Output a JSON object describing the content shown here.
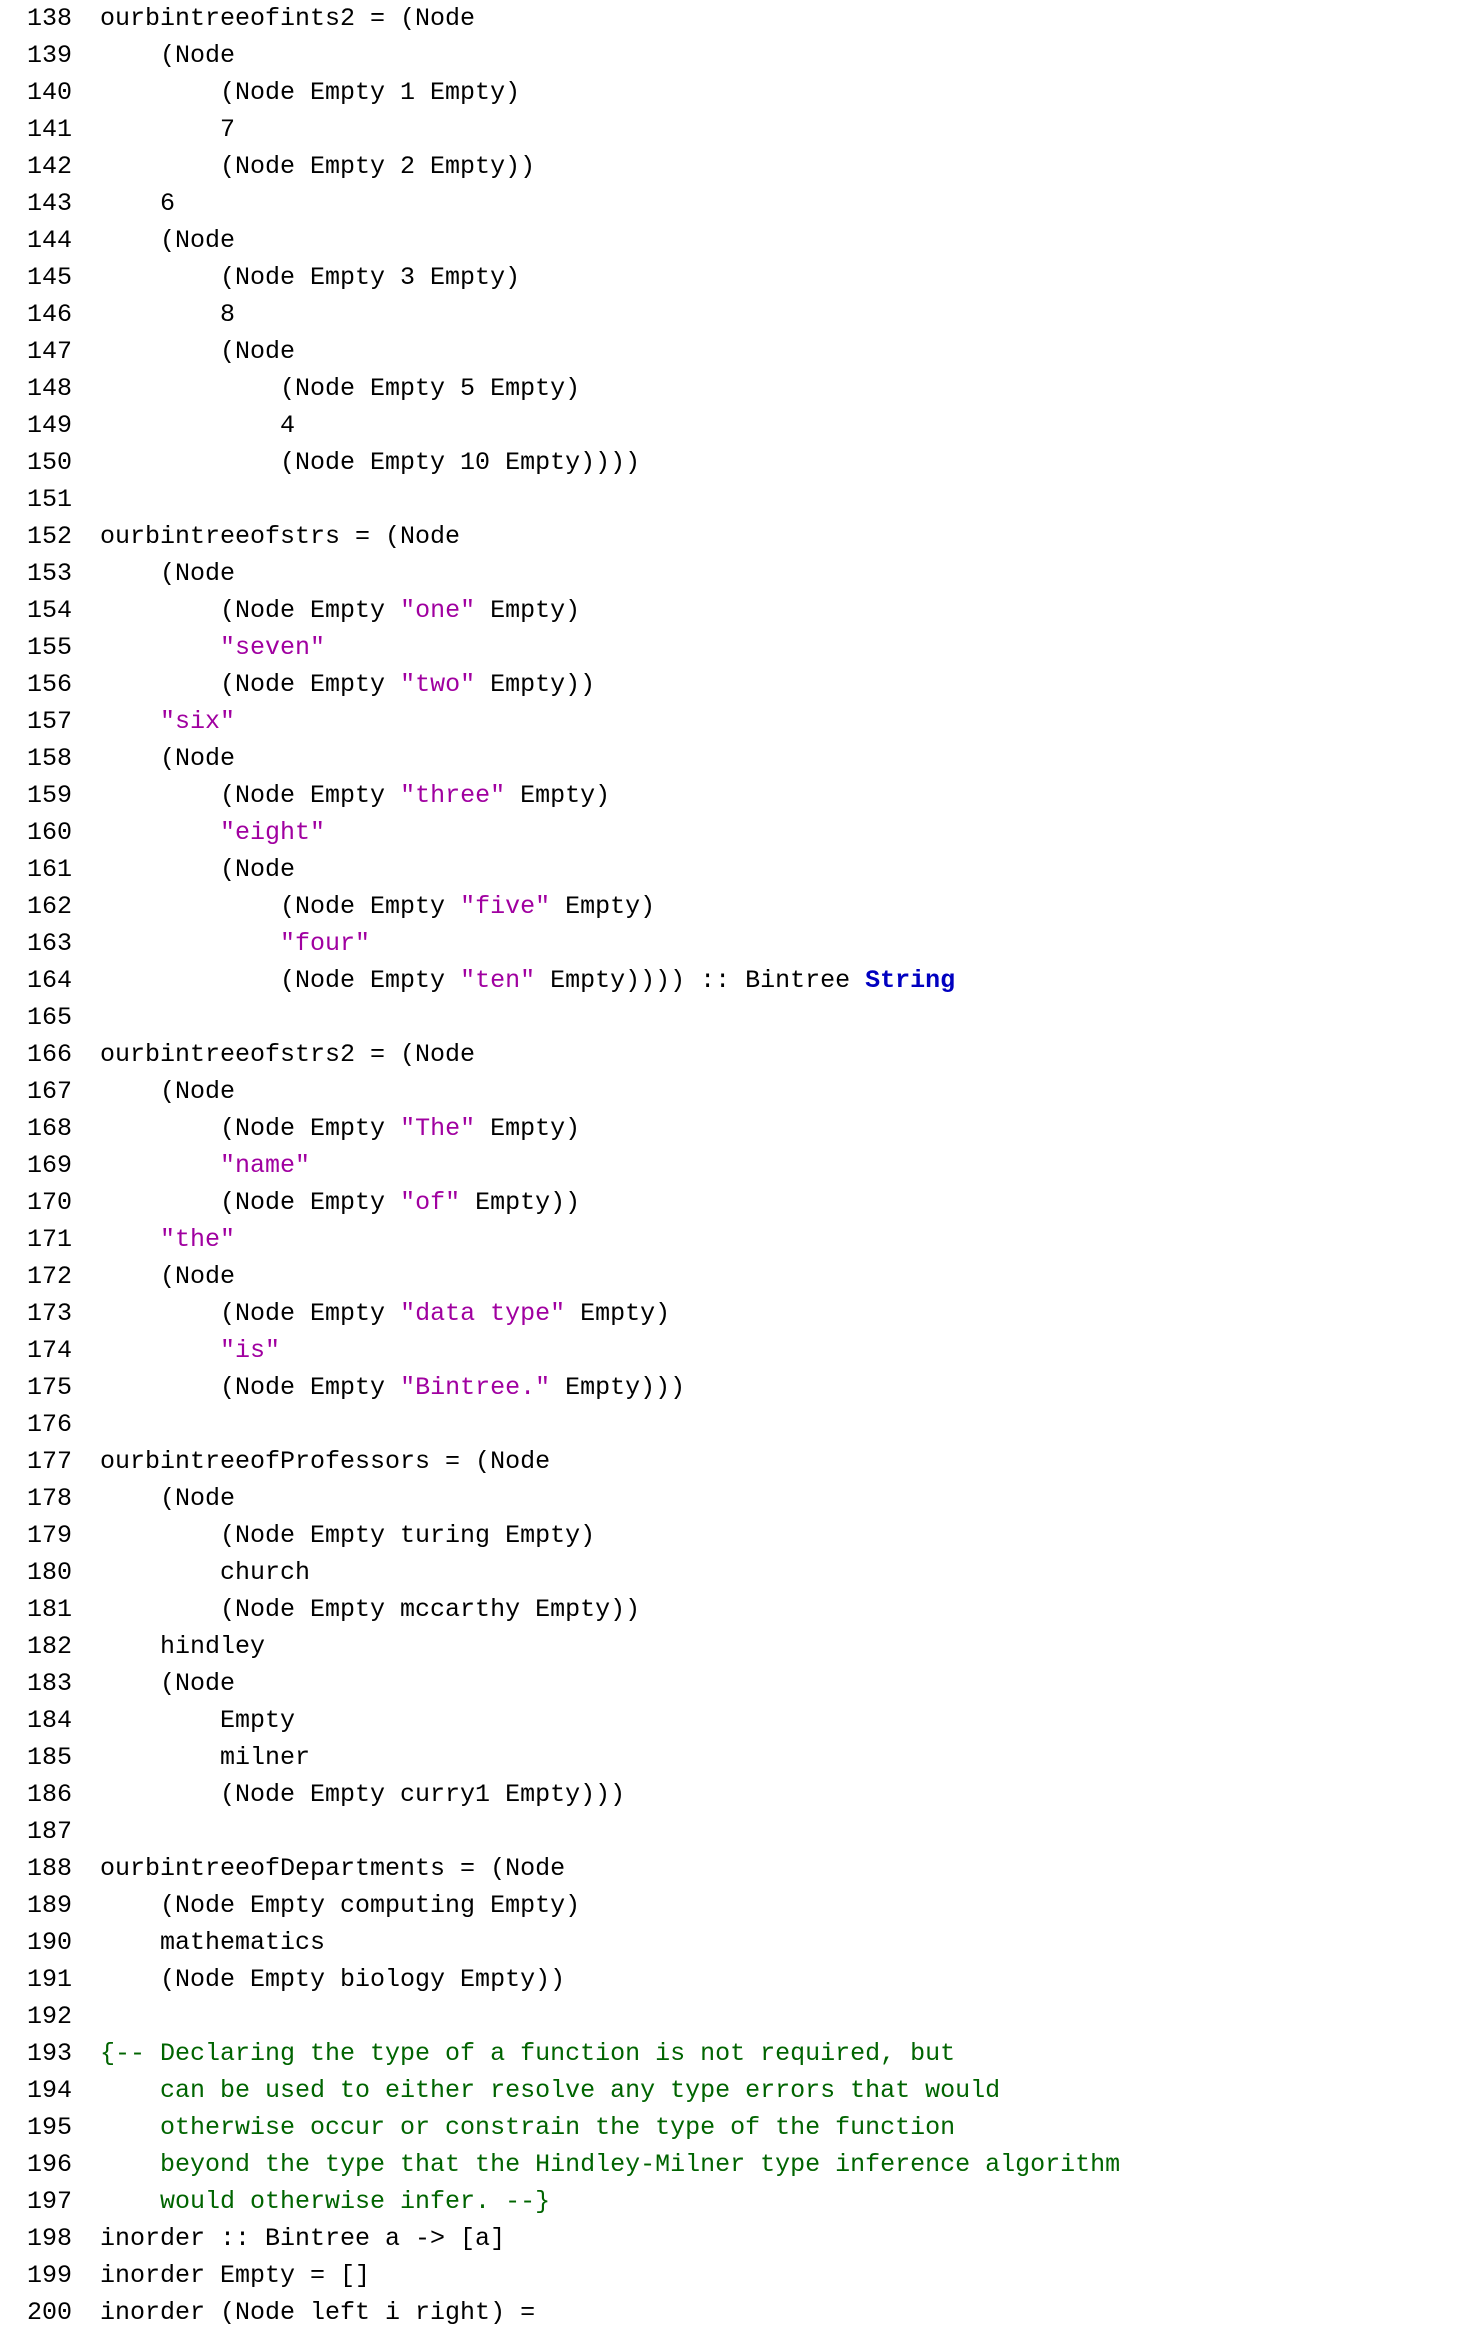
{
  "lines": [
    {
      "n": 138,
      "segs": [
        {
          "t": "ourbintreeofints2 = (Node"
        }
      ]
    },
    {
      "n": 139,
      "segs": [
        {
          "t": "    (Node"
        }
      ]
    },
    {
      "n": 140,
      "segs": [
        {
          "t": "        (Node Empty 1 Empty)"
        }
      ]
    },
    {
      "n": 141,
      "segs": [
        {
          "t": "        7"
        }
      ]
    },
    {
      "n": 142,
      "segs": [
        {
          "t": "        (Node Empty 2 Empty))"
        }
      ]
    },
    {
      "n": 143,
      "segs": [
        {
          "t": "    6"
        }
      ]
    },
    {
      "n": 144,
      "segs": [
        {
          "t": "    (Node"
        }
      ]
    },
    {
      "n": 145,
      "segs": [
        {
          "t": "        (Node Empty 3 Empty)"
        }
      ]
    },
    {
      "n": 146,
      "segs": [
        {
          "t": "        8"
        }
      ]
    },
    {
      "n": 147,
      "segs": [
        {
          "t": "        (Node"
        }
      ]
    },
    {
      "n": 148,
      "segs": [
        {
          "t": "            (Node Empty 5 Empty)"
        }
      ]
    },
    {
      "n": 149,
      "segs": [
        {
          "t": "            4"
        }
      ]
    },
    {
      "n": 150,
      "segs": [
        {
          "t": "            (Node Empty 10 Empty))))"
        }
      ]
    },
    {
      "n": 151,
      "segs": [
        {
          "t": ""
        }
      ]
    },
    {
      "n": 152,
      "segs": [
        {
          "t": "ourbintreeofstrs = (Node"
        }
      ]
    },
    {
      "n": 153,
      "segs": [
        {
          "t": "    (Node"
        }
      ]
    },
    {
      "n": 154,
      "segs": [
        {
          "t": "        (Node Empty "
        },
        {
          "t": "\"one\"",
          "c": "str"
        },
        {
          "t": " Empty)"
        }
      ]
    },
    {
      "n": 155,
      "segs": [
        {
          "t": "        "
        },
        {
          "t": "\"seven\"",
          "c": "str"
        }
      ]
    },
    {
      "n": 156,
      "segs": [
        {
          "t": "        (Node Empty "
        },
        {
          "t": "\"two\"",
          "c": "str"
        },
        {
          "t": " Empty))"
        }
      ]
    },
    {
      "n": 157,
      "segs": [
        {
          "t": "    "
        },
        {
          "t": "\"six\"",
          "c": "str"
        }
      ]
    },
    {
      "n": 158,
      "segs": [
        {
          "t": "    (Node"
        }
      ]
    },
    {
      "n": 159,
      "segs": [
        {
          "t": "        (Node Empty "
        },
        {
          "t": "\"three\"",
          "c": "str"
        },
        {
          "t": " Empty)"
        }
      ]
    },
    {
      "n": 160,
      "segs": [
        {
          "t": "        "
        },
        {
          "t": "\"eight\"",
          "c": "str"
        }
      ]
    },
    {
      "n": 161,
      "segs": [
        {
          "t": "        (Node"
        }
      ]
    },
    {
      "n": 162,
      "segs": [
        {
          "t": "            (Node Empty "
        },
        {
          "t": "\"five\"",
          "c": "str"
        },
        {
          "t": " Empty)"
        }
      ]
    },
    {
      "n": 163,
      "segs": [
        {
          "t": "            "
        },
        {
          "t": "\"four\"",
          "c": "str"
        }
      ]
    },
    {
      "n": 164,
      "segs": [
        {
          "t": "            (Node Empty "
        },
        {
          "t": "\"ten\"",
          "c": "str"
        },
        {
          "t": " Empty)))) :: Bintree "
        },
        {
          "t": "String",
          "c": "kw"
        }
      ]
    },
    {
      "n": 165,
      "segs": [
        {
          "t": ""
        }
      ]
    },
    {
      "n": 166,
      "segs": [
        {
          "t": "ourbintreeofstrs2 = (Node"
        }
      ]
    },
    {
      "n": 167,
      "segs": [
        {
          "t": "    (Node"
        }
      ]
    },
    {
      "n": 168,
      "segs": [
        {
          "t": "        (Node Empty "
        },
        {
          "t": "\"The\"",
          "c": "str"
        },
        {
          "t": " Empty)"
        }
      ]
    },
    {
      "n": 169,
      "segs": [
        {
          "t": "        "
        },
        {
          "t": "\"name\"",
          "c": "str"
        }
      ]
    },
    {
      "n": 170,
      "segs": [
        {
          "t": "        (Node Empty "
        },
        {
          "t": "\"of\"",
          "c": "str"
        },
        {
          "t": " Empty))"
        }
      ]
    },
    {
      "n": 171,
      "segs": [
        {
          "t": "    "
        },
        {
          "t": "\"the\"",
          "c": "str"
        }
      ]
    },
    {
      "n": 172,
      "segs": [
        {
          "t": "    (Node"
        }
      ]
    },
    {
      "n": 173,
      "segs": [
        {
          "t": "        (Node Empty "
        },
        {
          "t": "\"data type\"",
          "c": "str"
        },
        {
          "t": " Empty)"
        }
      ]
    },
    {
      "n": 174,
      "segs": [
        {
          "t": "        "
        },
        {
          "t": "\"is\"",
          "c": "str"
        }
      ]
    },
    {
      "n": 175,
      "segs": [
        {
          "t": "        (Node Empty "
        },
        {
          "t": "\"Bintree.\"",
          "c": "str"
        },
        {
          "t": " Empty)))"
        }
      ]
    },
    {
      "n": 176,
      "segs": [
        {
          "t": ""
        }
      ]
    },
    {
      "n": 177,
      "segs": [
        {
          "t": "ourbintreeofProfessors = (Node"
        }
      ]
    },
    {
      "n": 178,
      "segs": [
        {
          "t": "    (Node"
        }
      ]
    },
    {
      "n": 179,
      "segs": [
        {
          "t": "        (Node Empty turing Empty)"
        }
      ]
    },
    {
      "n": 180,
      "segs": [
        {
          "t": "        church"
        }
      ]
    },
    {
      "n": 181,
      "segs": [
        {
          "t": "        (Node Empty mccarthy Empty))"
        }
      ]
    },
    {
      "n": 182,
      "segs": [
        {
          "t": "    hindley"
        }
      ]
    },
    {
      "n": 183,
      "segs": [
        {
          "t": "    (Node"
        }
      ]
    },
    {
      "n": 184,
      "segs": [
        {
          "t": "        Empty"
        }
      ]
    },
    {
      "n": 185,
      "segs": [
        {
          "t": "        milner"
        }
      ]
    },
    {
      "n": 186,
      "segs": [
        {
          "t": "        (Node Empty curry1 Empty)))"
        }
      ]
    },
    {
      "n": 187,
      "segs": [
        {
          "t": ""
        }
      ]
    },
    {
      "n": 188,
      "segs": [
        {
          "t": "ourbintreeofDepartments = (Node"
        }
      ]
    },
    {
      "n": 189,
      "segs": [
        {
          "t": "    (Node Empty computing Empty)"
        }
      ]
    },
    {
      "n": 190,
      "segs": [
        {
          "t": "    mathematics"
        }
      ]
    },
    {
      "n": 191,
      "segs": [
        {
          "t": "    (Node Empty biology Empty))"
        }
      ]
    },
    {
      "n": 192,
      "segs": [
        {
          "t": ""
        }
      ]
    },
    {
      "n": 193,
      "segs": [
        {
          "t": "{-- Declaring the type of a function is not required, but",
          "c": "cmt"
        }
      ]
    },
    {
      "n": 194,
      "segs": [
        {
          "t": "    can be used to either resolve any type errors that would",
          "c": "cmt"
        }
      ]
    },
    {
      "n": 195,
      "segs": [
        {
          "t": "    otherwise occur or constrain the type of the function",
          "c": "cmt"
        }
      ]
    },
    {
      "n": 196,
      "segs": [
        {
          "t": "    beyond the type that the Hindley-Milner type inference algorithm",
          "c": "cmt"
        }
      ]
    },
    {
      "n": 197,
      "segs": [
        {
          "t": "    would otherwise infer. --}",
          "c": "cmt"
        }
      ]
    },
    {
      "n": 198,
      "segs": [
        {
          "t": "inorder :: Bintree a -> [a]"
        }
      ]
    },
    {
      "n": 199,
      "segs": [
        {
          "t": "inorder Empty = []"
        }
      ]
    },
    {
      "n": 200,
      "segs": [
        {
          "t": "inorder (Node left i right) ="
        }
      ]
    }
  ]
}
